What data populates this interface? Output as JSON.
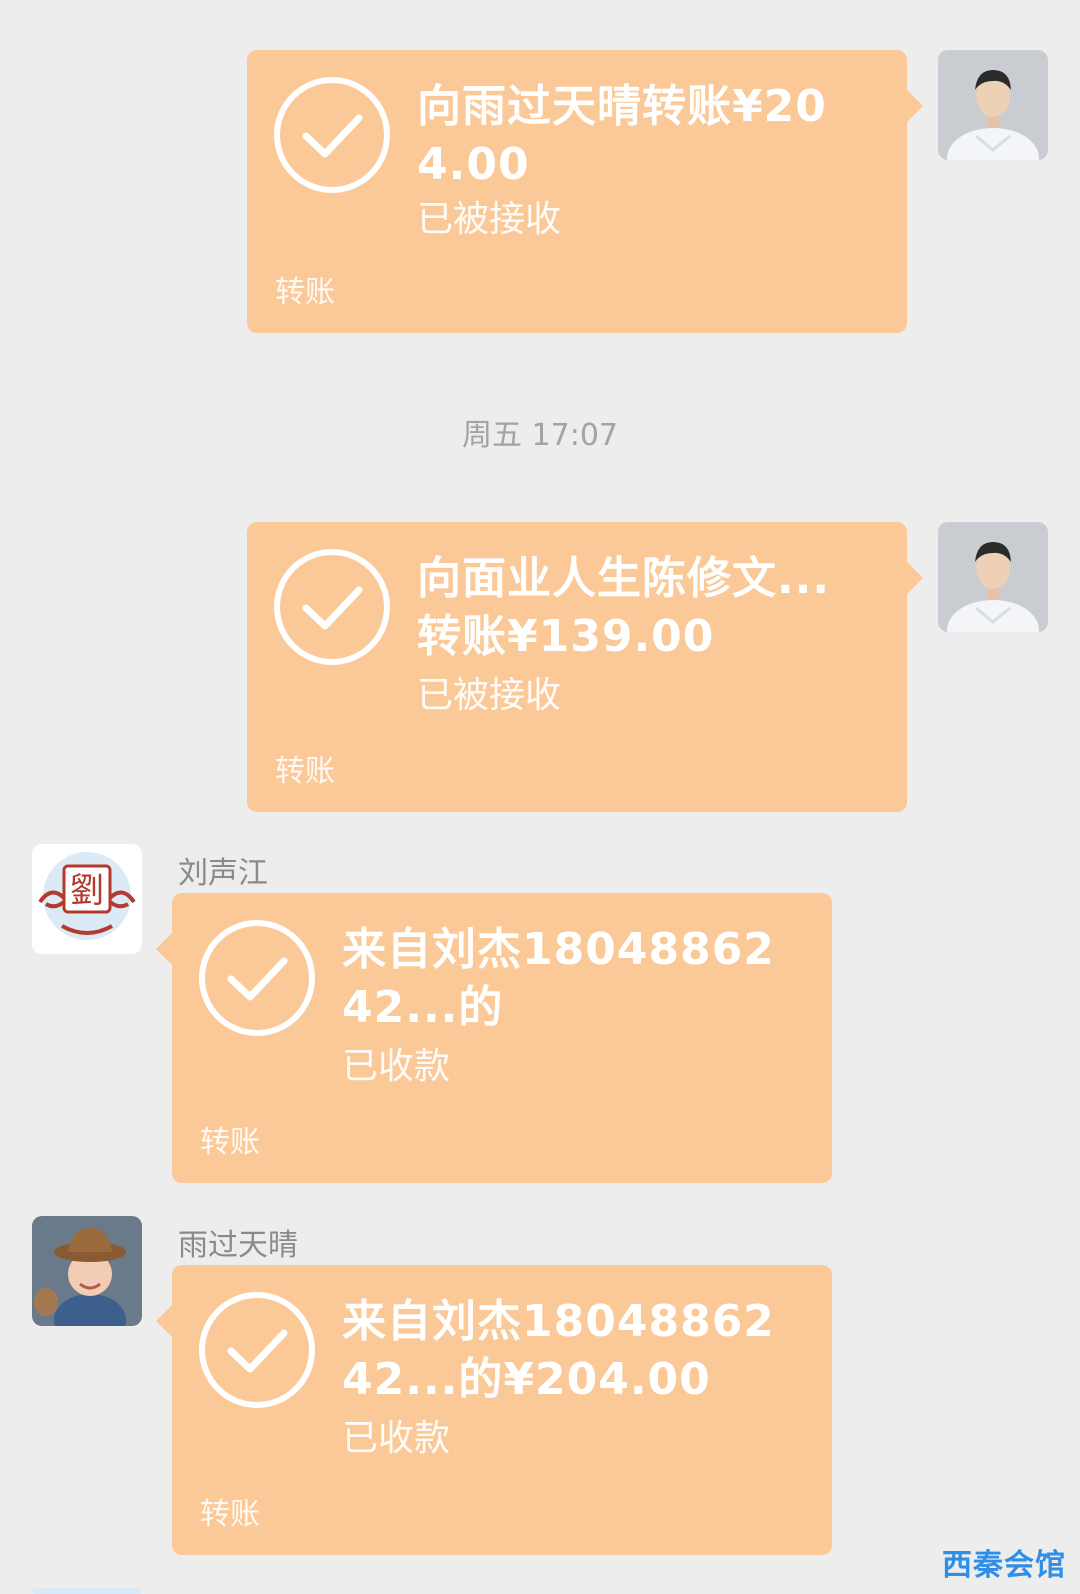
{
  "messages": [
    {
      "side": "right",
      "text": "向雨过天晴转账¥204.00",
      "status": "已被接收",
      "label": "转账"
    },
    {
      "side": "right",
      "text": "向面业人生陈修文...转账¥139.00",
      "status": "已被接收",
      "label": "转账"
    },
    {
      "side": "left",
      "sender": "刘声江",
      "text": "来自刘杰1804886242...的",
      "status": "已收款",
      "label": "转账"
    },
    {
      "side": "left",
      "sender": "雨过天晴",
      "text": "来自刘杰1804886242...的¥204.00",
      "status": "已收款",
      "label": "转账"
    }
  ],
  "timestamp": "周五 17:07",
  "avatar_seal_char": "劉",
  "watermark": "西秦会馆",
  "colors": {
    "background": "#ededed",
    "bubble": "#fbc998",
    "watermark": "#2f8fe8"
  }
}
